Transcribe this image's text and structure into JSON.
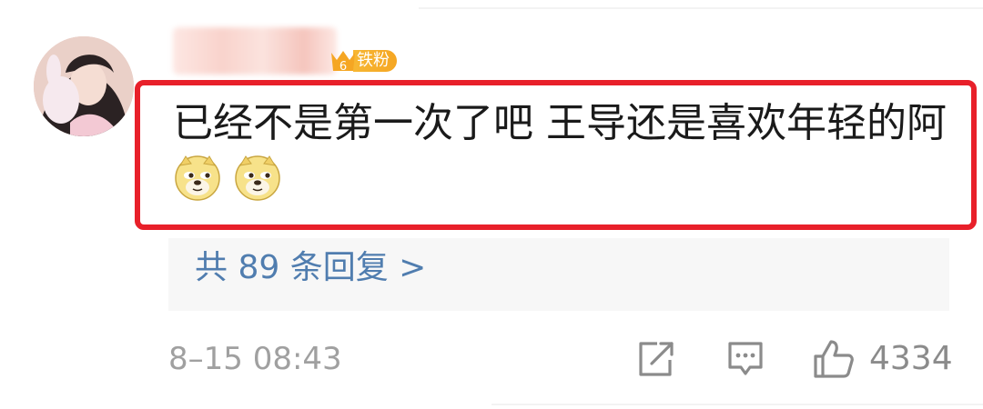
{
  "comment": {
    "badge_level": "6",
    "badge_label": "铁粉",
    "text": "已经不是第一次了吧 王导还是喜欢年轻的阿",
    "emojis": [
      "doge-emoji",
      "doge-emoji"
    ],
    "replies_link": "共 89 条回复 >",
    "timestamp": "8–15 08:43",
    "like_count": "4334"
  },
  "icons": {
    "share": "share-icon",
    "comment": "comment-icon",
    "like": "thumbs-up-icon"
  },
  "colors": {
    "highlight": "#e8202a",
    "link": "#507daf",
    "badge": "#f5a623"
  }
}
